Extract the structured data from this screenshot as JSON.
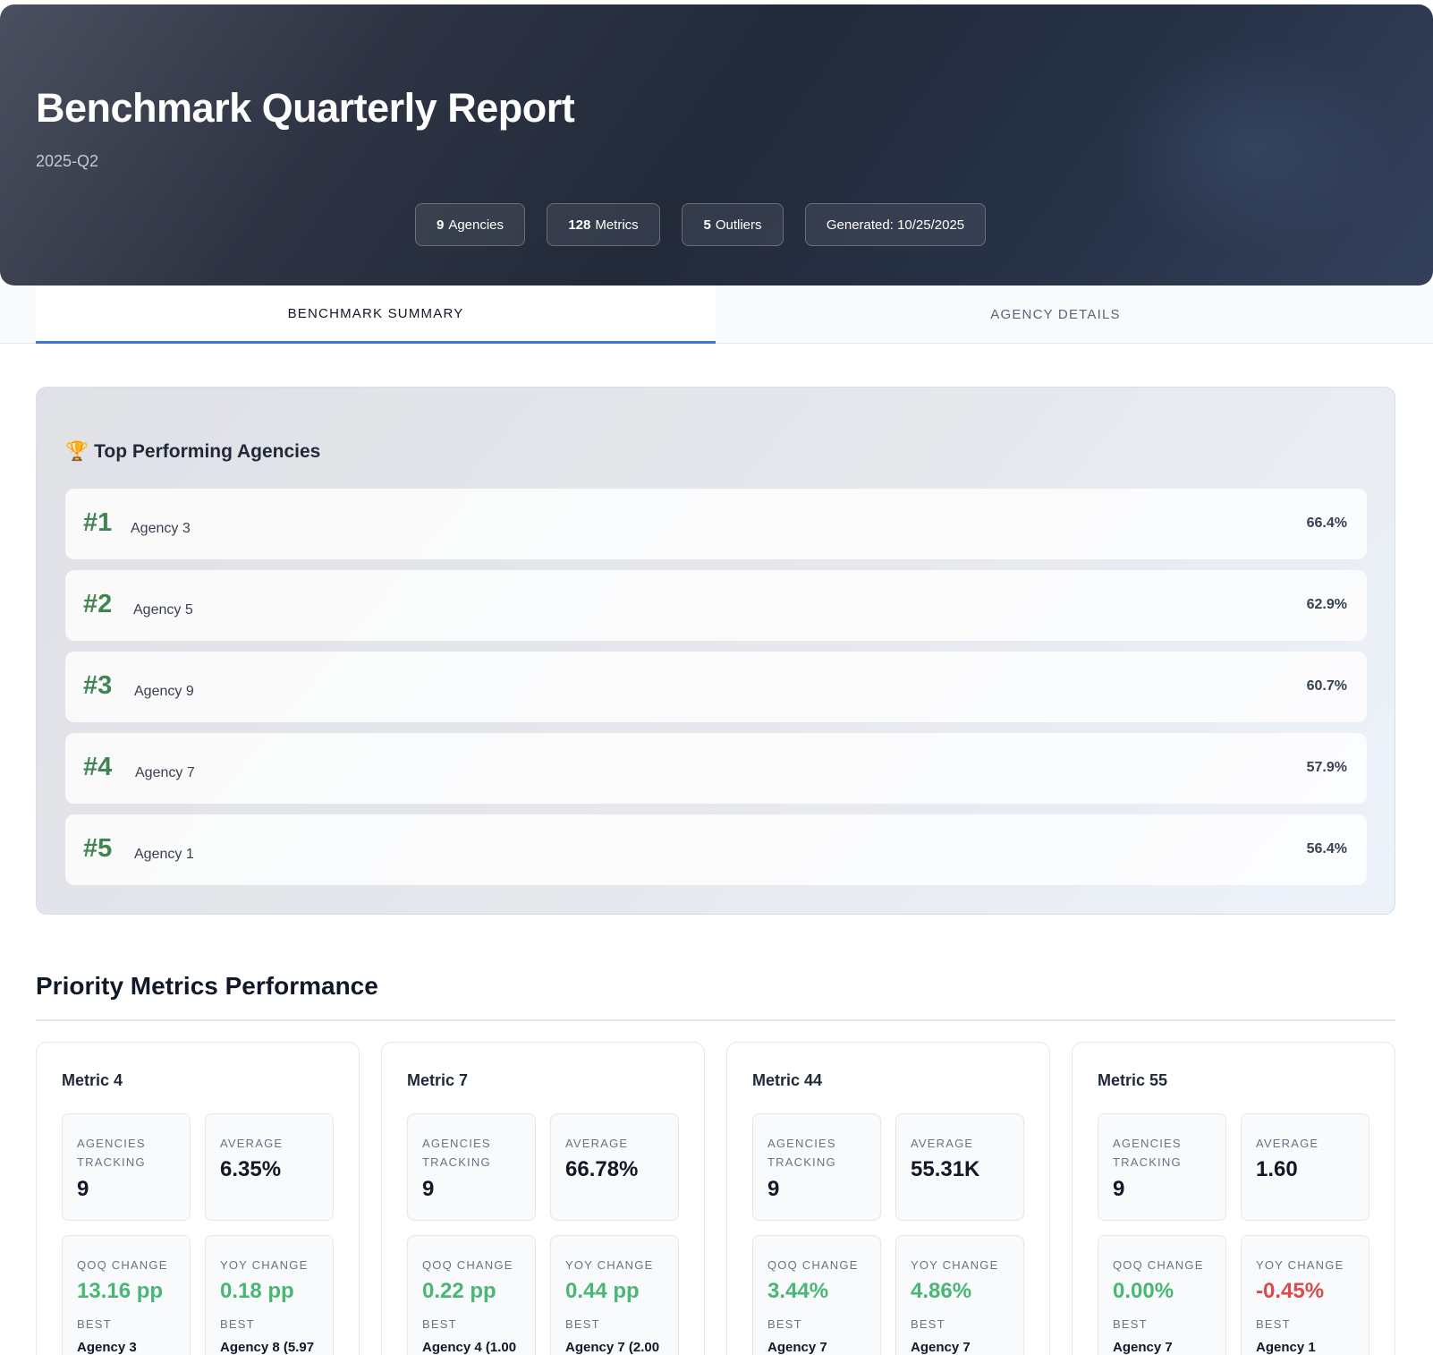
{
  "header": {
    "title": "Benchmark Quarterly Report",
    "period": "2025-Q2",
    "pills": [
      {
        "count": "9",
        "label": "Agencies"
      },
      {
        "count": "128",
        "label": "Metrics"
      },
      {
        "count": "5",
        "label": "Outliers"
      },
      {
        "count": "",
        "label": "Generated: 10/25/2025"
      }
    ]
  },
  "tabs": [
    {
      "label": "BENCHMARK SUMMARY",
      "active": true
    },
    {
      "label": "AGENCY DETAILS",
      "active": false
    }
  ],
  "top_performers": {
    "heading": "Top Performing Agencies",
    "icon": "trophy-icon",
    "items": [
      {
        "rank": "#1",
        "name": "Agency 3",
        "score": "66.4%"
      },
      {
        "rank": "#2",
        "name": "Agency 5",
        "score": "62.9%"
      },
      {
        "rank": "#3",
        "name": "Agency 9",
        "score": "60.7%"
      },
      {
        "rank": "#4",
        "name": "Agency 7",
        "score": "57.9%"
      },
      {
        "rank": "#5",
        "name": "Agency 1",
        "score": "56.4%"
      }
    ]
  },
  "priority": {
    "title": "Priority Metrics Performance",
    "labels": {
      "tracking": "AGENCIES TRACKING",
      "average": "AVERAGE",
      "qoq": "QOQ CHANGE",
      "yoy": "YOY CHANGE",
      "best": "BEST"
    },
    "metrics": [
      {
        "name": "Metric 4",
        "tracking": "9",
        "average": "6.35%",
        "qoq": "13.16 pp",
        "qoq_best": "Agency 3",
        "yoy": "0.18 pp",
        "yoy_best": "Agency 8 (5.97"
      },
      {
        "name": "Metric 7",
        "tracking": "9",
        "average": "66.78%",
        "qoq": "0.22 pp",
        "qoq_best": "Agency 4 (1.00",
        "yoy": "0.44 pp",
        "yoy_best": "Agency 7 (2.00"
      },
      {
        "name": "Metric 44",
        "tracking": "9",
        "average": "55.31K",
        "qoq": "3.44%",
        "qoq_best": "Agency 7",
        "yoy": "4.86%",
        "yoy_best": "Agency 7"
      },
      {
        "name": "Metric 55",
        "tracking": "9",
        "average": "1.60",
        "qoq": "0.00%",
        "qoq_best": "Agency 7",
        "yoy": "-0.45%",
        "yoy_best": "Agency 1"
      }
    ]
  },
  "colors": {
    "accent": "#3b74e0",
    "rank_green": "#3f8650",
    "positive": "#48b774",
    "negative": "#dc4b4b"
  }
}
